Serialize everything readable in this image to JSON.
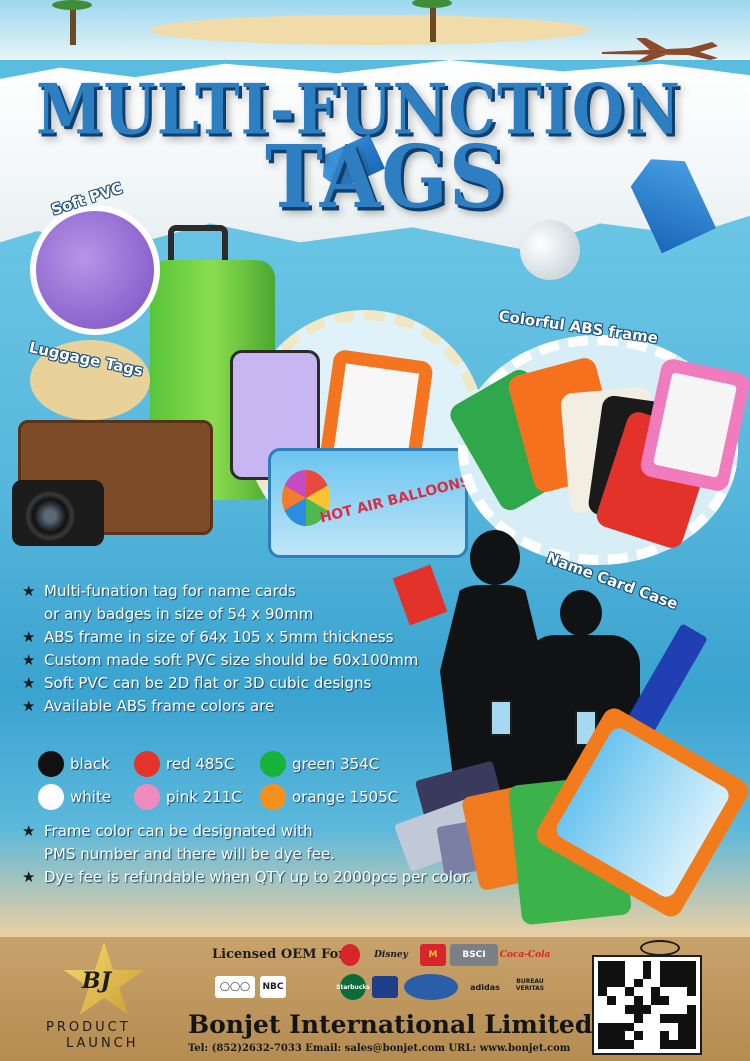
{
  "title": {
    "line1": "MULTI-FUNCTION",
    "line2": "TAGS"
  },
  "labels": {
    "soft_pvc": "Soft PVC",
    "luggage_tags": "Luggage Tags",
    "colorful_abs": "Colorful ABS frame",
    "name_card_case": "Name Card Case",
    "hot_air_balloons": "HOT AIR BALLOONS"
  },
  "features": [
    {
      "lines": [
        "Multi-funation tag for name cards",
        "or any badges in size of 54 x 90mm"
      ]
    },
    {
      "lines": [
        "ABS frame in size of 64x 105 x 5mm thickness"
      ]
    },
    {
      "lines": [
        "Custom made soft PVC size should be 60x100mm"
      ]
    },
    {
      "lines": [
        " Soft PVC can be 2D flat or 3D cubic designs"
      ]
    },
    {
      "lines": [
        "Available ABS frame colors are"
      ]
    }
  ],
  "colors": [
    {
      "label": "black",
      "hex": "#111111"
    },
    {
      "label": "red 485C",
      "hex": "#e5322b"
    },
    {
      "label": "green 354C",
      "hex": "#16b33a"
    },
    {
      "label": "white",
      "hex": "#ffffff"
    },
    {
      "label": "pink 211C",
      "hex": "#f08bbf"
    },
    {
      "label": "orange 1505C",
      "hex": "#f4911e"
    }
  ],
  "features_after": [
    {
      "lines": [
        " Frame color can be designated with",
        "PMS number and there will be dye fee."
      ]
    },
    {
      "lines": [
        "Dye fee is refundable when QTY up to 2000pcs per color."
      ]
    }
  ],
  "footer": {
    "logo": "BJ",
    "product": "PRODUCT",
    "launch": "LAUNCH",
    "licensed": "Licensed OEM For",
    "brands": [
      "Disney",
      "M",
      "BSCI",
      "Coca-Cola",
      "NBC",
      "Starbucks",
      "adidas",
      "BUREAU VERITAS"
    ],
    "company": "Bonjet International Limited",
    "contact": "Tel: (852)2632-7033    Email: sales@bonjet.com    URL: www.bonjet.com"
  },
  "icons": {
    "bullet": "star-icon"
  },
  "accent_colors": {
    "title": "#2e7fc1",
    "sea": "#4fb6dd",
    "sand": "#c7a36b"
  }
}
